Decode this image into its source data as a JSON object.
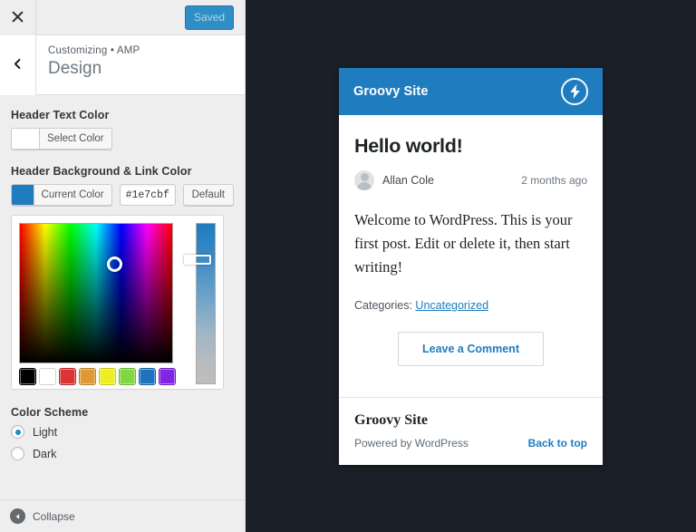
{
  "customizer": {
    "close_icon": "close-icon",
    "save_button_label": "Saved",
    "back_icon": "chevron-left-icon",
    "breadcrumb": "Customizing • AMP",
    "panel_title": "Design",
    "controls": {
      "header_text_color": {
        "label": "Header Text Color",
        "button_label": "Select Color",
        "swatch_color": "#ffffff"
      },
      "header_background_link_color": {
        "label": "Header Background & Link Color",
        "button_label": "Current Color",
        "hex_value": "#1e7cbf",
        "default_button_label": "Default",
        "swatch_color": "#1e7cbf"
      },
      "picker": {
        "palette": [
          "#000000",
          "#ffffff",
          "#dd3333",
          "#dd9933",
          "#eeee22",
          "#81d742",
          "#1e73be",
          "#8224e3"
        ]
      },
      "color_scheme": {
        "label": "Color Scheme",
        "options": [
          {
            "label": "Light",
            "selected": true
          },
          {
            "label": "Dark",
            "selected": false
          }
        ]
      }
    },
    "collapse_label": "Collapse",
    "collapse_icon": "collapse-arrow-icon"
  },
  "preview": {
    "site_title": "Groovy Site",
    "amp_icon": "amp-lightning-icon",
    "post": {
      "title": "Hello world!",
      "author": "Allan Cole",
      "date": "2 months ago",
      "excerpt": "Welcome to WordPress. This is your first post. Edit or delete it, then start writing!",
      "categories_label": "Categories:",
      "category_link": "Uncategorized",
      "comment_button": "Leave a Comment"
    },
    "footer": {
      "title": "Groovy Site",
      "powered_by": "Powered by WordPress",
      "back_to_top": "Back to top"
    }
  },
  "colors": {
    "accent": "#1e7cbf",
    "wp_blue": "#2e8ec6",
    "preview_bg": "#1b1f27"
  }
}
